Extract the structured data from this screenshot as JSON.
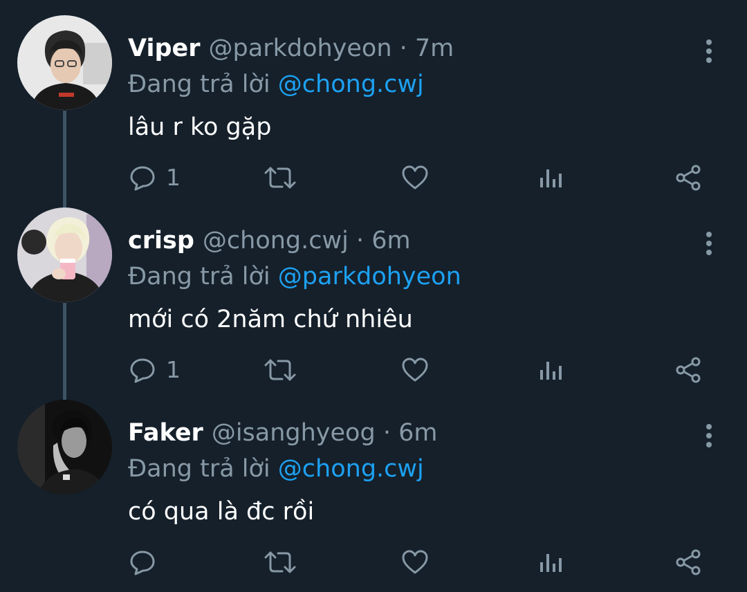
{
  "tweets": [
    {
      "name": "Viper",
      "handle": "@parkdohyeon",
      "time": "· 7m",
      "reply_prefix": "Đang trả lời",
      "reply_to": "@chong.cwj",
      "text": "lâu r ko gặp",
      "reply_count": "1",
      "avatar": "viper-avatar"
    },
    {
      "name": "crisp",
      "handle": "@chong.cwj",
      "time": "· 6m",
      "reply_prefix": "Đang trả lời",
      "reply_to": "@parkdohyeon",
      "text": "mới có 2năm chứ nhiêu",
      "reply_count": "1",
      "avatar": "crisp-avatar"
    },
    {
      "name": "Faker",
      "handle": "@isanghyeog",
      "time": "· 6m",
      "reply_prefix": "Đang trả lời",
      "reply_to": "@chong.cwj",
      "text": "có qua là đc rồi",
      "reply_count": "",
      "avatar": "faker-avatar"
    }
  ],
  "icons": {
    "reply": "reply-icon",
    "retweet": "retweet-icon",
    "like": "heart-icon",
    "analytics": "analytics-icon",
    "share": "share-icon",
    "more": "more-vertical-icon"
  },
  "colors": {
    "background": "#15202b",
    "name": "#ffffff",
    "secondary": "#8899a6",
    "mention": "#1da1f2",
    "thread_line": "#3d5466"
  }
}
